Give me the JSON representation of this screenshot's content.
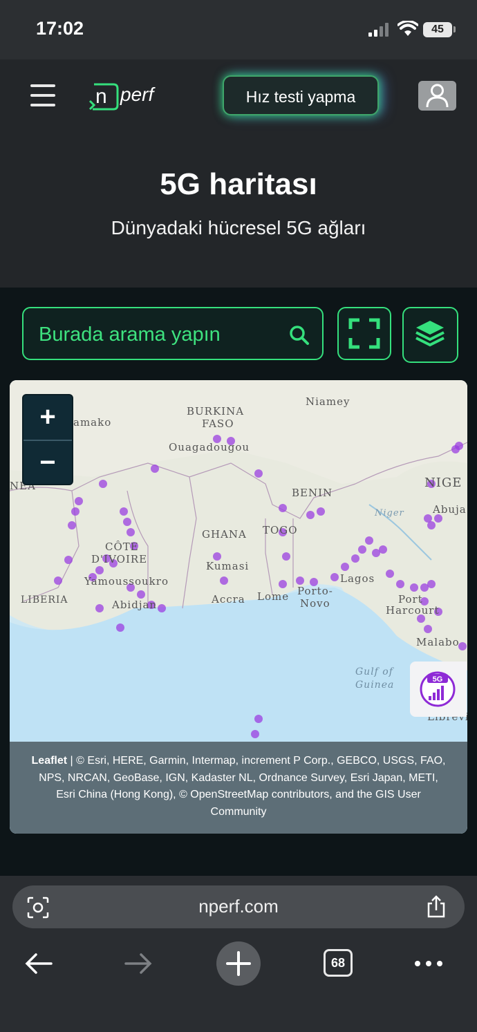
{
  "status_bar": {
    "time": "17:02",
    "battery": "45"
  },
  "header": {
    "logo_text": "nperf",
    "speed_test_button": "Hız testi yapma",
    "title": "5G haritası",
    "subtitle": "Dünyadaki hücresel 5G ağları"
  },
  "search": {
    "placeholder": "Burada arama yapın"
  },
  "map": {
    "zoom_in": "+",
    "zoom_out": "−",
    "labels": {
      "bamako": "amako",
      "burkina": "BURKINA",
      "faso": "FASO",
      "ouagadougou": "Ouagadougou",
      "niamey": "Niamey",
      "nea": "NEA",
      "niger_country": "NIGE",
      "benin": "BENIN",
      "niger_river": "Niger",
      "abuja": "Abuja",
      "ghana": "GHANA",
      "togo": "TOGO",
      "cote": "CÔTE",
      "divoire": "D'IVOIRE",
      "yamoussoukro": "Yamoussoukro",
      "kumasi": "Kumasi",
      "liberia": "LIBERIA",
      "lagos": "Lagos",
      "porto": "Porto-",
      "novo": "Novo",
      "port": "Port",
      "harcourt": "Harcourt",
      "accra": "Accra",
      "lome": "Lome",
      "abidjan": "Abidjan",
      "malabo": "Malabo",
      "gulf_of": "Gulf of",
      "guinea": "Guinea",
      "libreville": "Librevi"
    },
    "badge": "5G",
    "attribution_leaflet": "Leaflet",
    "attribution_rest": " | © Esri, HERE, Garmin, Intermap, increment P Corp., GEBCO, USGS, FAO, NPS, NRCAN, GeoBase, IGN, Kadaster NL, Ordnance Survey, Esri Japan, METI, Esri China (Hong Kong), © OpenStreetMap contributors, and the GIS User Community"
  },
  "browser": {
    "url": "nperf.com",
    "tab_count": "68"
  },
  "colors": {
    "accent_green": "#35e07d",
    "coverage_purple": "#9b3fe0"
  }
}
